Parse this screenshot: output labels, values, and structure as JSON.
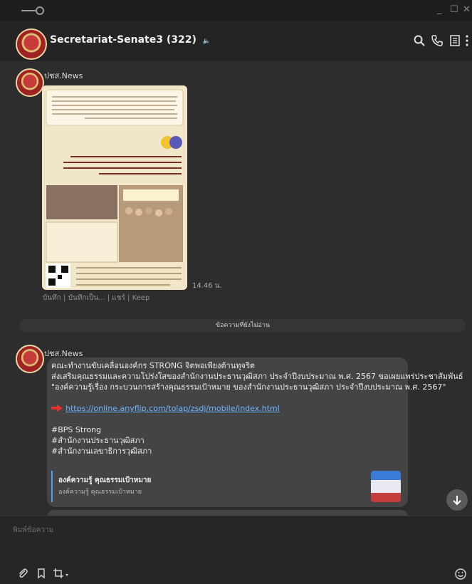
{
  "window": {
    "minimize": "_",
    "maximize": "☐",
    "close": "✕"
  },
  "header": {
    "title": "Secretariat-Senate3 (322)",
    "mute_glyph": "🔈"
  },
  "message1": {
    "sender": "ปชส.News",
    "time": "14.46 น.",
    "actions": "บันทึก | บันทึกเป็น... | แชร์ | Keep"
  },
  "unread_label": "ข้อความที่ยังไม่อ่าน",
  "message2": {
    "sender": "ปชส.News",
    "lines": [
      "คณะทำงานขับเคลื่อนองค์กร STRONG จิตพอเพียงต้านทุจริต",
      "ส่งเสริมคุณธรรมและความโปร่งใสของสำนักงานประธานวุฒิสภา ประจำปีงบประมาณ พ.ศ. 2567 ขอเผยแพร่ประชาสัมพันธ์",
      "\"องค์ความรู้เรื่อง กระบวนการสร้างคุณธรรมเป้าหมาย ของสำนักงานประธานวุฒิสภา ประจำปีงบประมาณ พ.ศ. 2567\""
    ],
    "link": "https://online.anyflip.com/tolap/zsdj/mobile/index.html",
    "hashtags": [
      "#BPS Strong",
      "#สำนักงานประธานวุฒิสภา",
      "#สำนักงานเลขาธิการวุฒิสภา"
    ],
    "preview_title": "องค์ความรู้ คุณธรรมเป้าหมาย",
    "preview_subtitle": "องค์ความรู้ คุณธรรมเป้าหมาย"
  },
  "composer": {
    "placeholder": "พิมพ์ข้อความ"
  },
  "colors": {
    "accent_link": "#6fb3ff",
    "bubble": "#444444",
    "preview_bar": "#4d9ff0"
  }
}
